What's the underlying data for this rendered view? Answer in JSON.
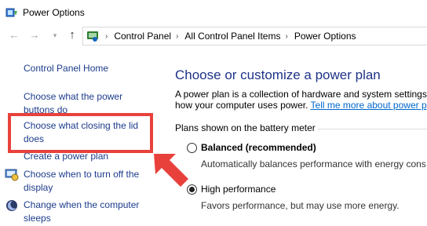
{
  "window": {
    "title": "Power Options",
    "title_icon": "power-options-icon"
  },
  "navigation": {
    "back_icon": "back-arrow-icon",
    "forward_icon": "forward-arrow-icon",
    "recent_icon": "chevron-down-icon",
    "up_icon": "up-arrow-icon",
    "breadcrumb": [
      "Control Panel",
      "All Control Panel Items",
      "Power Options"
    ]
  },
  "sidebar": {
    "home_label": "Control Panel Home",
    "items": [
      {
        "label_line1": "Choose what the power",
        "label_line2": "buttons do",
        "icon": ""
      },
      {
        "label_line1": "Choose what closing the lid",
        "label_line2": "does",
        "icon": ""
      },
      {
        "label_line1": "Create a power plan",
        "label_line2": "",
        "icon": ""
      },
      {
        "label_line1": "Choose when to turn off the",
        "label_line2": "display",
        "icon": "display-settings-icon"
      },
      {
        "label_line1": "Change when the computer",
        "label_line2": "sleeps",
        "icon": "moon-sleep-icon"
      }
    ]
  },
  "main": {
    "heading": "Choose or customize a power plan",
    "intro_line1": "A power plan is a collection of hardware and system settings",
    "intro_line2": "how your computer uses power.",
    "intro_link": "Tell me more about power p",
    "section_label": "Plans shown on the battery meter",
    "plans": [
      {
        "name": "Balanced (recommended)",
        "description": "Automatically balances performance with energy cons",
        "selected": false
      },
      {
        "name": "High performance",
        "description": "Favors performance, but may use more energy.",
        "selected": true
      }
    ]
  },
  "annotation": {
    "color": "#e8413c"
  },
  "colors": {
    "sidebar_link": "#1c3c8c",
    "heading": "#1e3287",
    "link": "#0066cc"
  }
}
